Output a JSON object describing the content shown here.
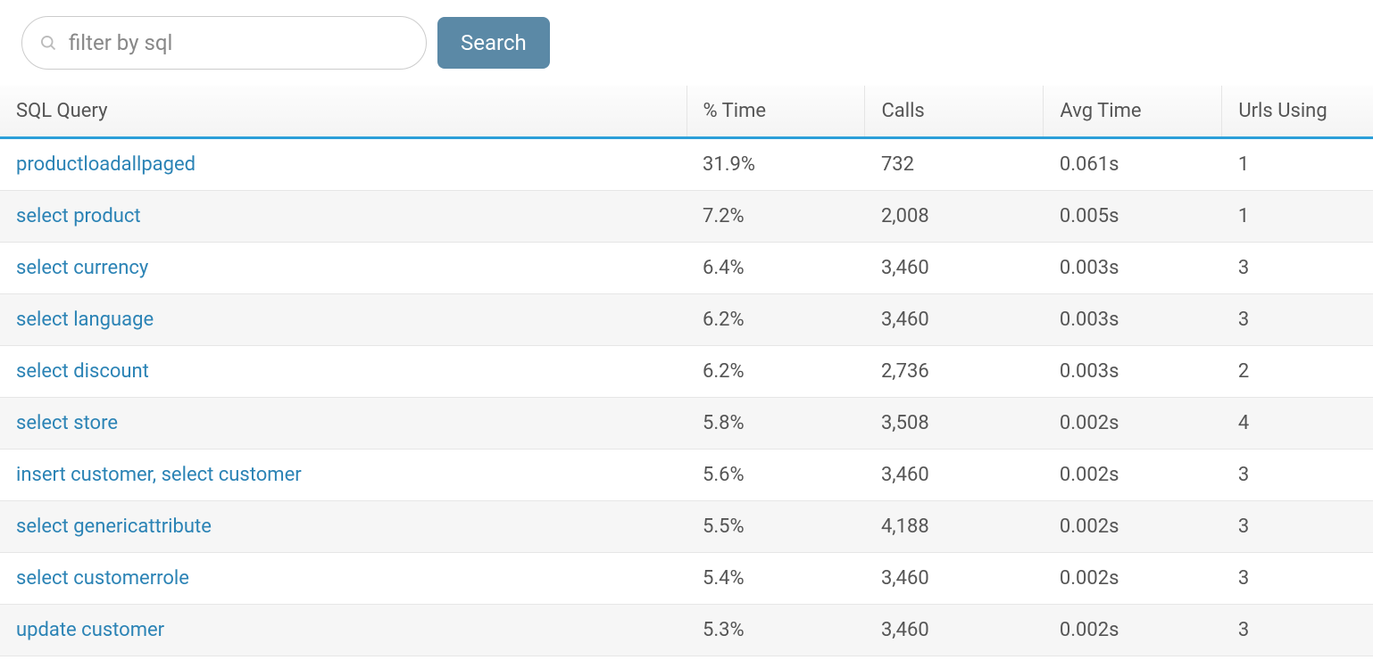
{
  "search": {
    "placeholder": "filter by sql",
    "button_label": "Search"
  },
  "table": {
    "headers": {
      "query": "SQL Query",
      "pct_time": "% Time",
      "calls": "Calls",
      "avg_time": "Avg Time",
      "urls_using": "Urls Using"
    },
    "rows": [
      {
        "query": "productloadallpaged",
        "pct_time": "31.9%",
        "calls": "732",
        "avg_time": "0.061s",
        "urls_using": "1"
      },
      {
        "query": "select product",
        "pct_time": "7.2%",
        "calls": "2,008",
        "avg_time": "0.005s",
        "urls_using": "1"
      },
      {
        "query": "select currency",
        "pct_time": "6.4%",
        "calls": "3,460",
        "avg_time": "0.003s",
        "urls_using": "3"
      },
      {
        "query": "select language",
        "pct_time": "6.2%",
        "calls": "3,460",
        "avg_time": "0.003s",
        "urls_using": "3"
      },
      {
        "query": "select discount",
        "pct_time": "6.2%",
        "calls": "2,736",
        "avg_time": "0.003s",
        "urls_using": "2"
      },
      {
        "query": "select store",
        "pct_time": "5.8%",
        "calls": "3,508",
        "avg_time": "0.002s",
        "urls_using": "4"
      },
      {
        "query": "insert customer, select customer",
        "pct_time": "5.6%",
        "calls": "3,460",
        "avg_time": "0.002s",
        "urls_using": "3"
      },
      {
        "query": "select genericattribute",
        "pct_time": "5.5%",
        "calls": "4,188",
        "avg_time": "0.002s",
        "urls_using": "3"
      },
      {
        "query": "select customerrole",
        "pct_time": "5.4%",
        "calls": "3,460",
        "avg_time": "0.002s",
        "urls_using": "3"
      },
      {
        "query": "update customer",
        "pct_time": "5.3%",
        "calls": "3,460",
        "avg_time": "0.002s",
        "urls_using": "3"
      }
    ]
  }
}
